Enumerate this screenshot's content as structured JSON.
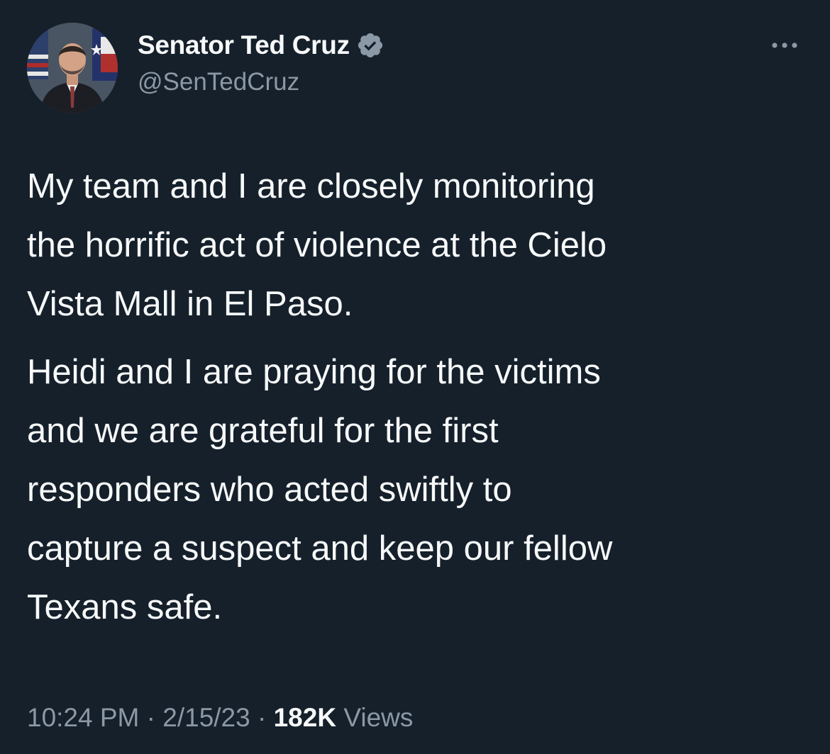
{
  "author": {
    "display_name": "Senator Ted Cruz",
    "handle": "@SenTedCruz",
    "verified": true,
    "verified_icon": "verified-badge-icon",
    "avatar_icon": "profile-photo"
  },
  "more_icon": "more-options-icon",
  "tweet": {
    "paragraphs": [
      "My team and I are closely monitoring\nthe horrific act of violence at the Cielo\nVista Mall in El Paso.",
      "Heidi and I are praying for the victims\nand we are grateful for the first\nresponders who acted swiftly to\ncapture a suspect and keep our fellow\nTexans safe."
    ]
  },
  "meta": {
    "time": "10:24 PM",
    "separator": "·",
    "date": "2/15/23",
    "views_count": "182K",
    "views_label": "Views"
  },
  "colors": {
    "background": "#15202b",
    "primary_text": "#f7f9f9",
    "secondary_text": "#8b98a5",
    "verified_badge": "#8b98a5"
  }
}
